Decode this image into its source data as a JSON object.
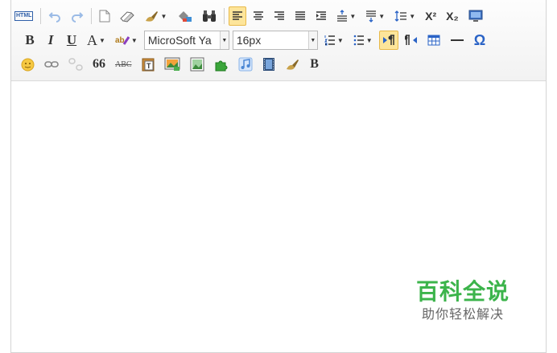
{
  "toolbar": {
    "html_label": "HTML",
    "font_family": "MicroSoft Ya",
    "font_size": "16px",
    "bold_label": "B",
    "italic_label": "I",
    "underline_label": "U",
    "font_color_label": "A",
    "quote_label": "66",
    "strike_label": "ABC",
    "format_label": "B",
    "omega_label": "Ω",
    "superscript_label": "X²",
    "subscript_label": "X₂"
  },
  "watermark": {
    "title": "百科全说",
    "subtitle": "助你轻松解决"
  },
  "colors": {
    "accent_active": "#fde59a",
    "brand_green": "#3cb44b",
    "icon_blue": "#2a63c6"
  }
}
